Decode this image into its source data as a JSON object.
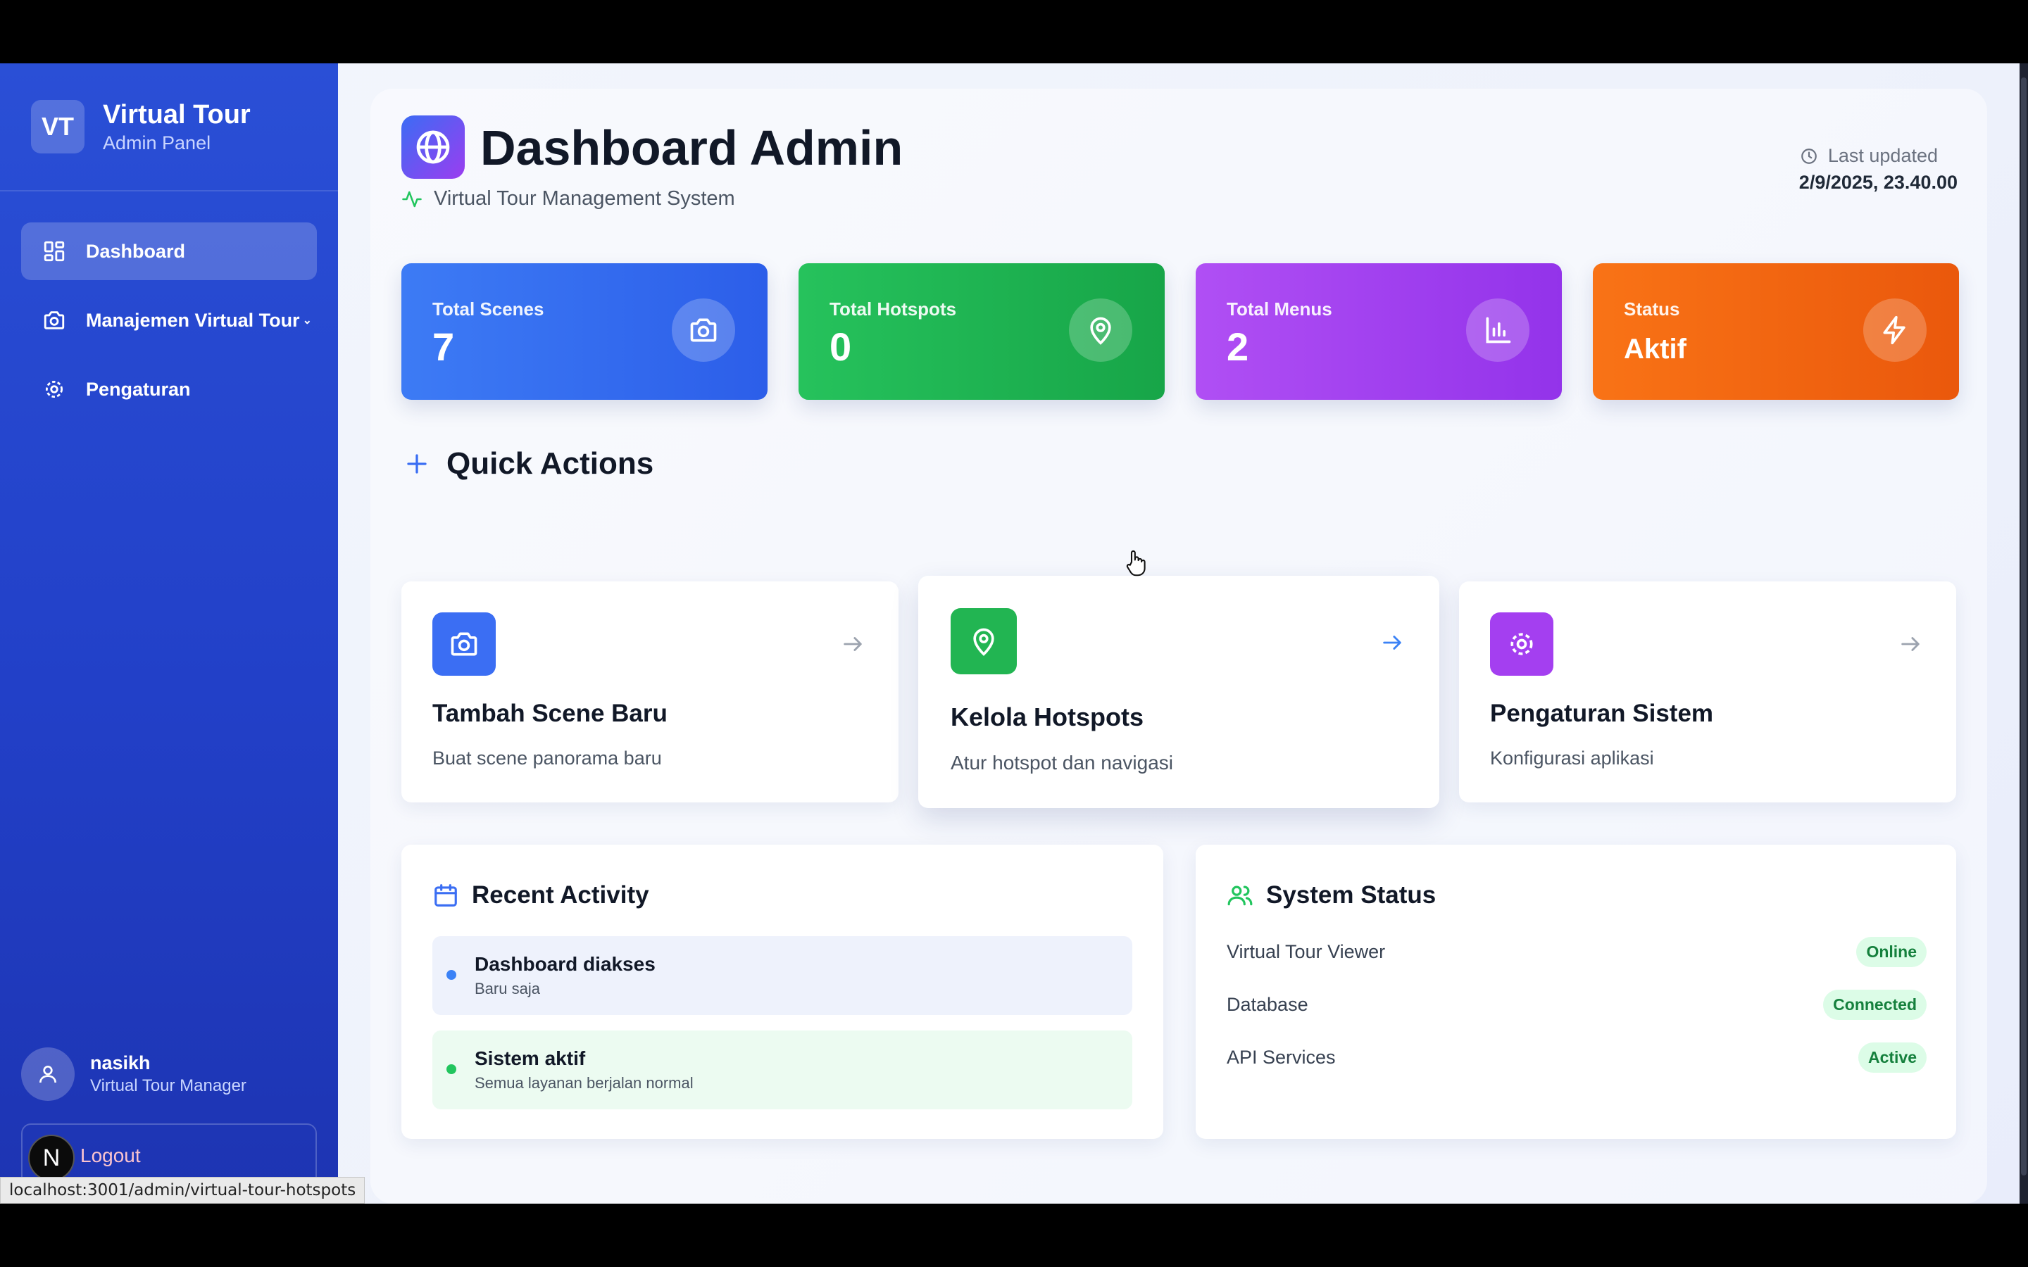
{
  "sidebar": {
    "logo_initials": "VT",
    "brand_title": "Virtual Tour",
    "brand_subtitle": "Admin Panel",
    "items": [
      {
        "label": "Dashboard",
        "icon": "dashboard-grid-icon",
        "active": true
      },
      {
        "label": "Manajemen Virtual Tour",
        "icon": "camera-icon",
        "active": false,
        "has_submenu": true
      },
      {
        "label": "Pengaturan",
        "icon": "gear-icon",
        "active": false
      }
    ],
    "user": {
      "name": "nasikh",
      "role": "Virtual Tour Manager",
      "icon": "user-icon"
    },
    "logout_label": "Logout",
    "n_badge": "N"
  },
  "status_bar_url": "localhost:3001/admin/virtual-tour-hotspots",
  "header": {
    "title": "Dashboard Admin",
    "title_icon": "globe-icon",
    "subtitle": "Virtual Tour Management System",
    "subtitle_icon": "activity-icon",
    "last_updated_label": "Last updated",
    "last_updated_value": "2/9/2025, 23.40.00"
  },
  "stats": [
    {
      "label": "Total Scenes",
      "value": "7",
      "icon": "camera-icon",
      "color": "#3b6ef3"
    },
    {
      "label": "Total Hotspots",
      "value": "0",
      "icon": "map-pin-icon",
      "color": "#22b552"
    },
    {
      "label": "Total Menus",
      "value": "2",
      "icon": "bar-chart-icon",
      "color": "#a43ff0"
    },
    {
      "label": "Status",
      "value": "Aktif",
      "icon": "lightning-icon",
      "color": "#f46614"
    }
  ],
  "quick_actions": {
    "title": "Quick Actions",
    "items": [
      {
        "title": "Tambah Scene Baru",
        "desc": "Buat scene panorama baru",
        "icon": "camera-icon",
        "color": "#3b6ef3"
      },
      {
        "title": "Kelola Hotspots",
        "desc": "Atur hotspot dan navigasi",
        "icon": "map-pin-icon",
        "color": "#22b552"
      },
      {
        "title": "Pengaturan Sistem",
        "desc": "Konfigurasi aplikasi",
        "icon": "gear-icon",
        "color": "#a43ff0"
      }
    ]
  },
  "recent_activity": {
    "title": "Recent Activity",
    "items": [
      {
        "title": "Dashboard diakses",
        "time": "Baru saja",
        "color": "#3b82f6"
      },
      {
        "title": "Sistem aktif",
        "time": "Semua layanan berjalan normal",
        "color": "#22c55e"
      }
    ]
  },
  "system_status": {
    "title": "System Status",
    "items": [
      {
        "label": "Virtual Tour Viewer",
        "status": "Online"
      },
      {
        "label": "Database",
        "status": "Connected"
      },
      {
        "label": "API Services",
        "status": "Active"
      }
    ]
  }
}
